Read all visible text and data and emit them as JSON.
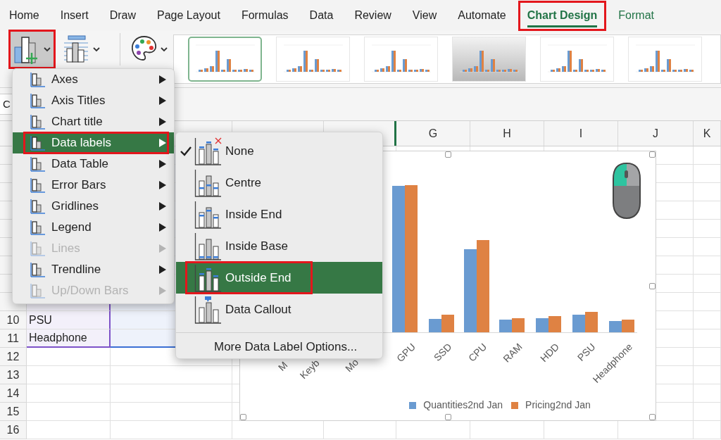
{
  "ribbon_tabs": [
    {
      "label": "Home",
      "selected": false,
      "kind": "standard",
      "highlighted": false
    },
    {
      "label": "Insert",
      "selected": false,
      "kind": "standard",
      "highlighted": false
    },
    {
      "label": "Draw",
      "selected": false,
      "kind": "standard",
      "highlighted": false
    },
    {
      "label": "Page Layout",
      "selected": false,
      "kind": "standard",
      "highlighted": false
    },
    {
      "label": "Formulas",
      "selected": false,
      "kind": "standard",
      "highlighted": false
    },
    {
      "label": "Data",
      "selected": false,
      "kind": "standard",
      "highlighted": false
    },
    {
      "label": "Review",
      "selected": false,
      "kind": "standard",
      "highlighted": false
    },
    {
      "label": "View",
      "selected": false,
      "kind": "standard",
      "highlighted": false
    },
    {
      "label": "Automate",
      "selected": false,
      "kind": "standard",
      "highlighted": false
    },
    {
      "label": "Chart Design",
      "selected": true,
      "kind": "contextual",
      "highlighted": true
    },
    {
      "label": "Format",
      "selected": false,
      "kind": "contextual",
      "highlighted": false
    }
  ],
  "toolbar_buttons": [
    {
      "kind": "add_chart_element",
      "pressed": true,
      "highlighted": true
    },
    {
      "kind": "quick_layout",
      "pressed": false,
      "highlighted": false
    },
    {
      "kind": "change_colors",
      "pressed": false,
      "highlighted": false
    }
  ],
  "chart_styles": [
    {
      "kind": "plain",
      "selected": true
    },
    {
      "kind": "plain",
      "selected": false
    },
    {
      "kind": "plain",
      "selected": false
    },
    {
      "kind": "gradient",
      "selected": false
    },
    {
      "kind": "plain",
      "selected": false
    },
    {
      "kind": "plain",
      "selected": false
    }
  ],
  "name_box": {
    "value": "C"
  },
  "column_headers": [
    "G",
    "H",
    "I",
    "J",
    "K"
  ],
  "rows": [
    {
      "number": "10",
      "column_a": "PSU",
      "in_chart_range": true
    },
    {
      "number": "11",
      "column_a": "Headphone",
      "in_chart_range": true
    },
    {
      "number": "12",
      "in_chart_range": false
    },
    {
      "number": "13",
      "in_chart_range": false
    },
    {
      "number": "14",
      "in_chart_range": false
    },
    {
      "number": "15",
      "in_chart_range": false
    },
    {
      "number": "16",
      "in_chart_range": false
    }
  ],
  "chart_elements_menu": [
    {
      "label": "Axes",
      "disabled": false,
      "selected": false,
      "highlighted": false
    },
    {
      "label": "Axis Titles",
      "disabled": false,
      "selected": false,
      "highlighted": false
    },
    {
      "label": "Chart title",
      "disabled": false,
      "selected": false,
      "highlighted": false
    },
    {
      "label": "Data labels",
      "disabled": false,
      "selected": true,
      "highlighted": true
    },
    {
      "label": "Data Table",
      "disabled": false,
      "selected": false,
      "highlighted": false
    },
    {
      "label": "Error Bars",
      "disabled": false,
      "selected": false,
      "highlighted": false
    },
    {
      "label": "Gridlines",
      "disabled": false,
      "selected": false,
      "highlighted": false
    },
    {
      "label": "Legend",
      "disabled": false,
      "selected": false,
      "highlighted": false
    },
    {
      "label": "Lines",
      "disabled": true,
      "selected": false,
      "highlighted": false
    },
    {
      "label": "Trendline",
      "disabled": false,
      "selected": false,
      "highlighted": false
    },
    {
      "label": "Up/Down Bars",
      "disabled": true,
      "selected": false,
      "highlighted": false
    }
  ],
  "data_labels_menu": {
    "items": [
      {
        "label": "None",
        "kind": "none",
        "checked": true,
        "selected": false,
        "highlighted": false
      },
      {
        "label": "Centre",
        "kind": "centre",
        "checked": false,
        "selected": false,
        "highlighted": false
      },
      {
        "label": "Inside End",
        "kind": "inside_end",
        "checked": false,
        "selected": false,
        "highlighted": false
      },
      {
        "label": "Inside Base",
        "kind": "inside_base",
        "checked": false,
        "selected": false,
        "highlighted": false
      },
      {
        "label": "Outside End",
        "kind": "outside_end",
        "checked": false,
        "selected": true,
        "highlighted": true
      },
      {
        "label": "Data Callout",
        "kind": "callout",
        "checked": false,
        "selected": false,
        "highlighted": false
      }
    ],
    "footer": "More Data Label Options..."
  },
  "chart": {
    "category_labels": [
      "M",
      "Keyb",
      "Mo",
      "GPU",
      "SSD",
      "CPU",
      "RAM",
      "HDD",
      "PSU",
      "Headphone"
    ],
    "legend": [
      {
        "label": "Quantities2nd Jan",
        "color": "#6a9bd1"
      },
      {
        "label": "Pricing2nd Jan",
        "color": "#df8243"
      }
    ]
  }
}
